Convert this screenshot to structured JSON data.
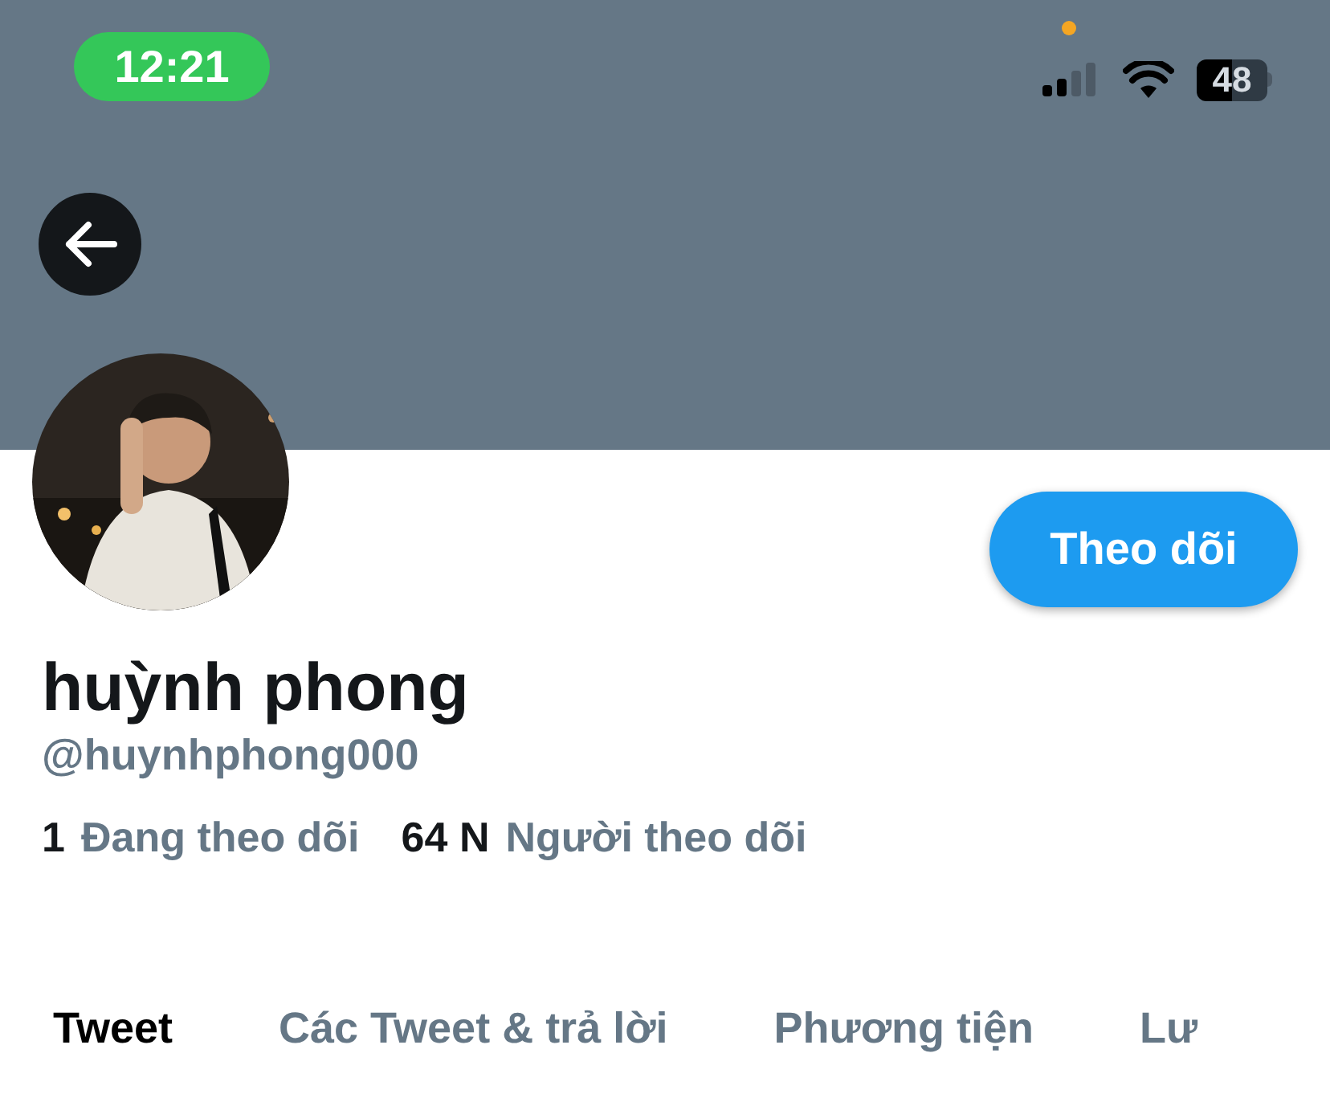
{
  "status_bar": {
    "time": "12:21",
    "battery": "48"
  },
  "profile": {
    "name": "huỳnh phong",
    "handle": "@huynhphong000",
    "follow_button": "Theo dõi",
    "stats": [
      {
        "count": "1",
        "label": "Đang theo dõi"
      },
      {
        "count": "64 N",
        "label": "Người theo dõi"
      }
    ]
  },
  "tabs": [
    {
      "label": "Tweet",
      "selected": true
    },
    {
      "label": "Các Tweet & trả lời",
      "selected": false
    },
    {
      "label": "Phương tiện",
      "selected": false
    },
    {
      "label": "Lư",
      "selected": false
    }
  ]
}
